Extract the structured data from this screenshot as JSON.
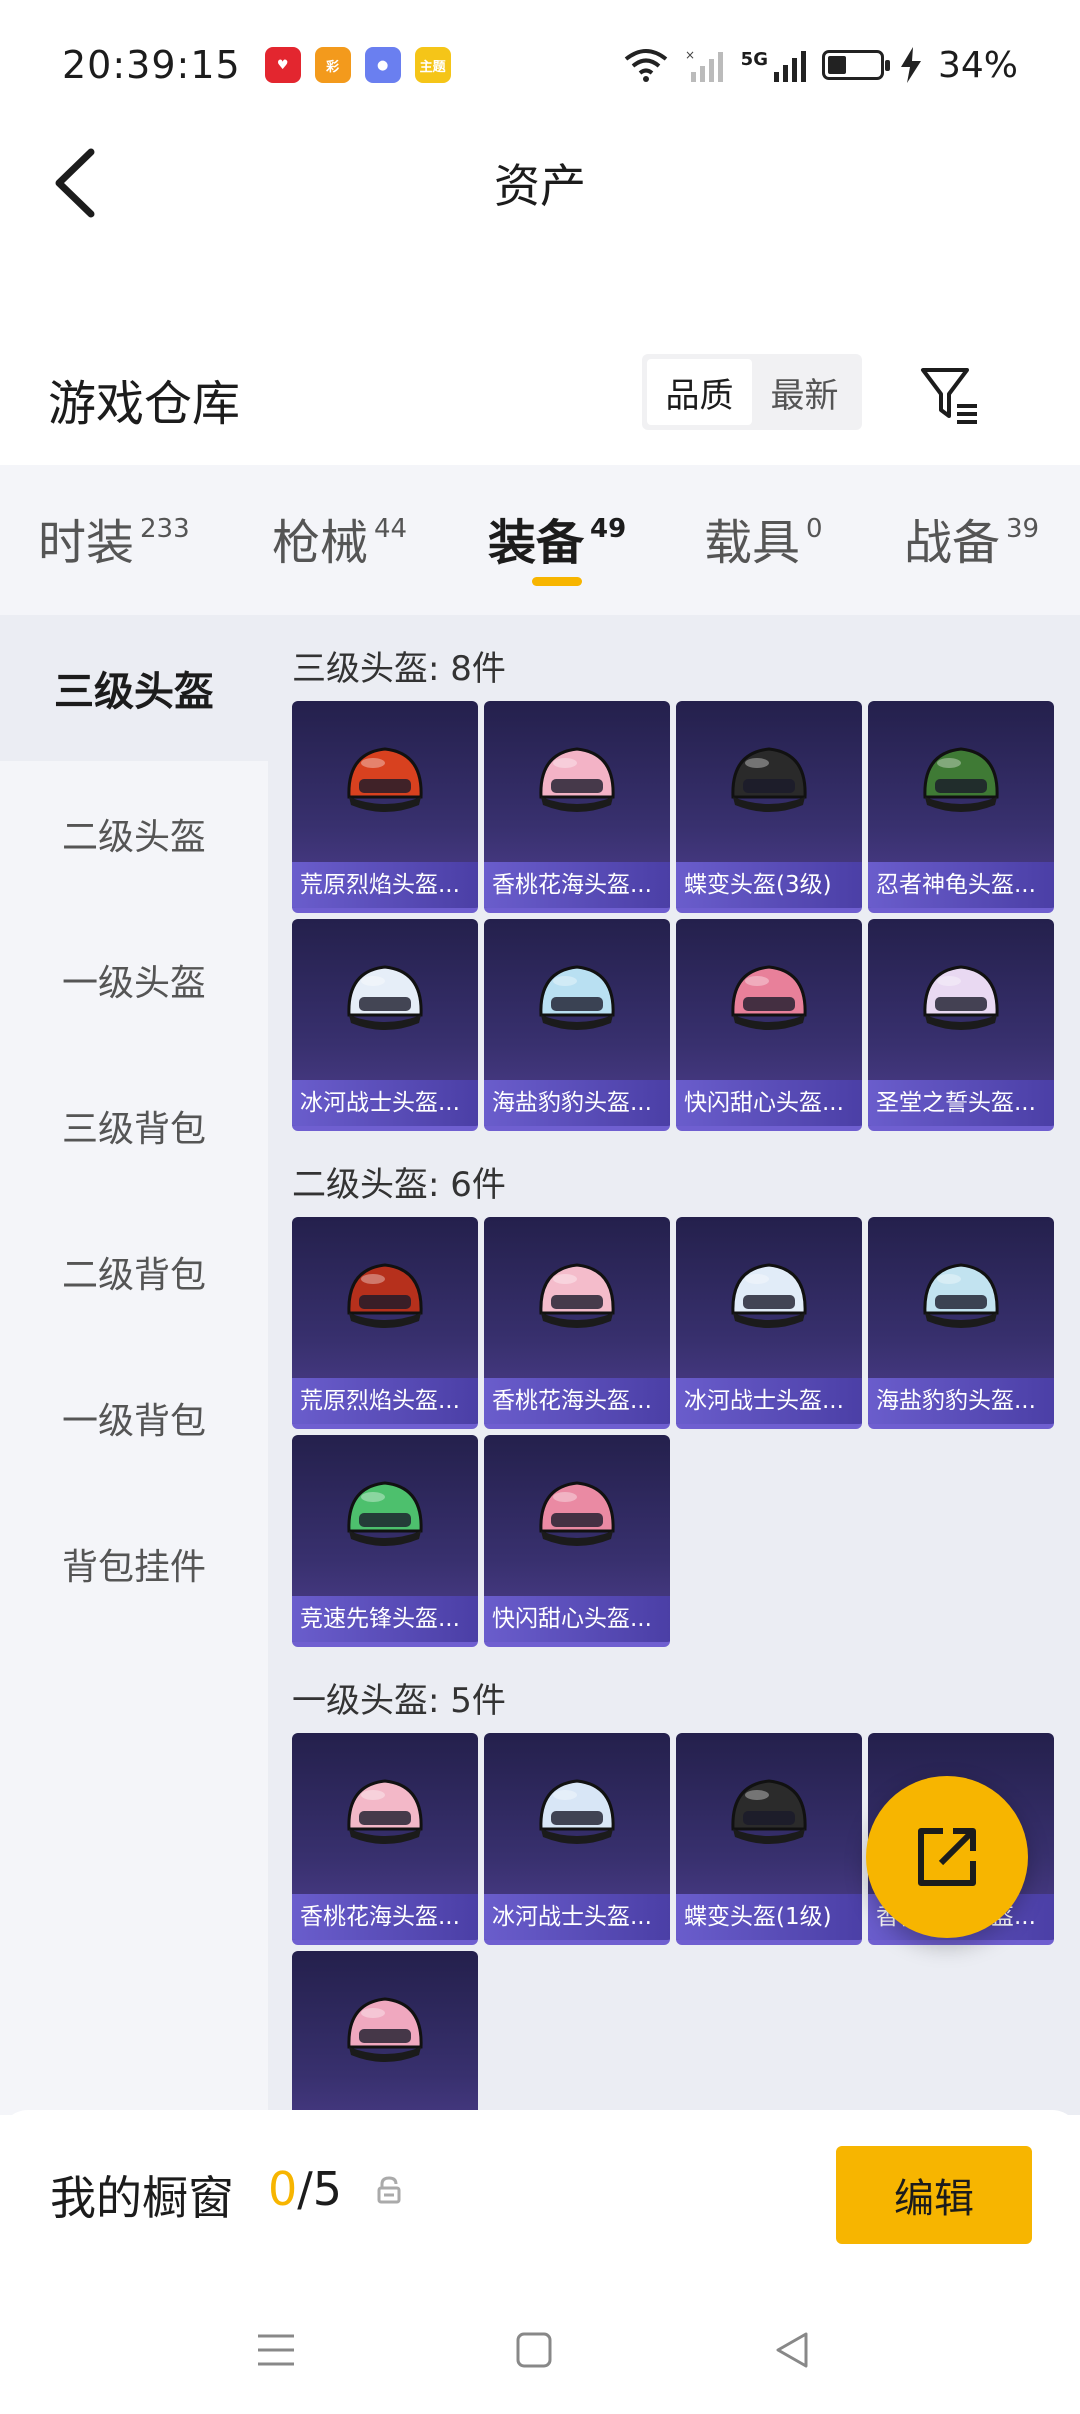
{
  "status_bar": {
    "time": "20:39:15",
    "battery": "34%",
    "battery_level": 0.34,
    "signal": "5G",
    "notifications": [
      {
        "icon": "heart-app-icon",
        "color": "#e3262f",
        "text": "♥"
      },
      {
        "icon": "lottery-app-icon",
        "color": "#f39a1c",
        "text": "彩"
      },
      {
        "icon": "astronaut-app-icon",
        "color": "#6a7ff0",
        "text": "●"
      },
      {
        "icon": "theme-app-icon",
        "color": "#f5c518",
        "text": "主题"
      }
    ]
  },
  "header": {
    "title": "资产"
  },
  "warehouse": {
    "title": "游戏仓库",
    "sort_options": [
      "品质",
      "最新"
    ],
    "active_sort": "品质"
  },
  "tabs": [
    {
      "label": "时装",
      "count": "233"
    },
    {
      "label": "枪械",
      "count": "44"
    },
    {
      "label": "装备",
      "count": "49"
    },
    {
      "label": "载具",
      "count": "0"
    },
    {
      "label": "战备",
      "count": "39"
    }
  ],
  "active_tab": "装备",
  "sidebar": [
    {
      "label": "三级头盔"
    },
    {
      "label": "二级头盔"
    },
    {
      "label": "一级头盔"
    },
    {
      "label": "三级背包"
    },
    {
      "label": "二级背包"
    },
    {
      "label": "一级背包"
    },
    {
      "label": "背包挂件"
    }
  ],
  "sections": [
    {
      "title": "三级头盔: 8件",
      "items": [
        {
          "name": "荒原烈焰头盔...",
          "color": "#d8411f"
        },
        {
          "name": "香桃花海头盔...",
          "color": "#f3b3c6"
        },
        {
          "name": "蝶变头盔(3级)",
          "color": "#2a2a2a"
        },
        {
          "name": "忍者神龟头盔...",
          "color": "#3f7a35"
        },
        {
          "name": "冰河战士头盔...",
          "color": "#e6eef8"
        },
        {
          "name": "海盐豹豹头盔...",
          "color": "#b9e0f2"
        },
        {
          "name": "快闪甜心头盔...",
          "color": "#e8809a"
        },
        {
          "name": "圣堂之誓头盔...",
          "color": "#e9d9f2"
        }
      ]
    },
    {
      "title": "二级头盔: 6件",
      "items": [
        {
          "name": "荒原烈焰头盔...",
          "color": "#b6301c"
        },
        {
          "name": "香桃花海头盔...",
          "color": "#f4bccb"
        },
        {
          "name": "冰河战士头盔...",
          "color": "#e1ecf8"
        },
        {
          "name": "海盐豹豹头盔...",
          "color": "#c2e3f0"
        },
        {
          "name": "竞速先锋头盔...",
          "color": "#4dc06d"
        },
        {
          "name": "快闪甜心头盔...",
          "color": "#ea8aa3"
        }
      ]
    },
    {
      "title": "一级头盔: 5件",
      "items": [
        {
          "name": "香桃花海头盔...",
          "color": "#f3b8c8"
        },
        {
          "name": "冰河战士头盔...",
          "color": "#d8e6f6"
        },
        {
          "name": "蝶变头盔(1级)",
          "color": "#2b2b2b"
        },
        {
          "name": "香桃花海头盔...",
          "color": "#f6d7dd"
        },
        {
          "name": "",
          "color": "#f0a8bf"
        }
      ]
    }
  ],
  "window": {
    "label": "我的橱窗",
    "current": "0",
    "max": "/5",
    "edit_label": "编辑"
  },
  "colors": {
    "accent": "#f7b500",
    "card": "#38306e"
  }
}
